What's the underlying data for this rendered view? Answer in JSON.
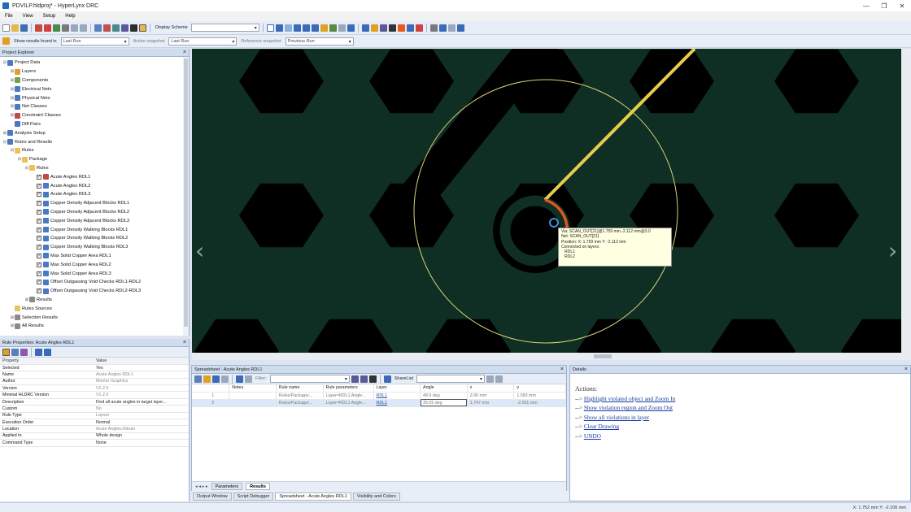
{
  "window": {
    "title": "PDVILP.hldproj* - HyperLynx DRC",
    "minimize": "—",
    "maximize": "❐",
    "close": "✕"
  },
  "menu": [
    "File",
    "View",
    "Setup",
    "Help"
  ],
  "toolbar1": {
    "display_scheme_label": "Display Scheme",
    "display_scheme_value": ""
  },
  "toolbar2": {
    "show_label": "Show results found in",
    "show_value": "Last Run",
    "active_label": "Active snapshot",
    "active_value": "Last Run",
    "reference_label": "Reference snapshot",
    "reference_value": "Previous Run"
  },
  "explorer": {
    "title": "Project Explorer",
    "items": [
      {
        "label": "Project Data",
        "level": 0,
        "exp": "⊟",
        "icon": "#4a78c2"
      },
      {
        "label": "Layers",
        "level": 1,
        "exp": "⊞",
        "icon": "#e0a030"
      },
      {
        "label": "Components",
        "level": 1,
        "exp": "⊞",
        "icon": "#7aa04a"
      },
      {
        "label": "Electrical Nets",
        "level": 1,
        "exp": "⊞",
        "icon": "#4a78c2"
      },
      {
        "label": "Physical Nets",
        "level": 1,
        "exp": "⊞",
        "icon": "#4a78c2"
      },
      {
        "label": "Net Classes",
        "level": 1,
        "exp": "⊞",
        "icon": "#4a78c2"
      },
      {
        "label": "Constraint Classes",
        "level": 1,
        "exp": "⊞",
        "icon": "#c04a4a"
      },
      {
        "label": "Diff Pairs",
        "level": 1,
        "exp": "",
        "icon": "#4a78c2"
      },
      {
        "label": "Analysis Setup",
        "level": 0,
        "exp": "⊞",
        "icon": "#4a78c2"
      },
      {
        "label": "Rules and Results",
        "level": 0,
        "exp": "⊟",
        "icon": "#4a78c2"
      },
      {
        "label": "Rules",
        "level": 1,
        "exp": "⊟",
        "icon": "#e8c45a"
      },
      {
        "label": "Package",
        "level": 2,
        "exp": "⊟",
        "icon": "#e8c45a"
      },
      {
        "label": "Rules",
        "level": 3,
        "exp": "⊟",
        "icon": "#e8c45a"
      },
      {
        "label": "Acute Angles RDL1",
        "level": 4,
        "cb": true,
        "icon": "#c04a4a"
      },
      {
        "label": "Acute Angles RDL2",
        "level": 4,
        "cb": true,
        "icon": "#4a78c2"
      },
      {
        "label": "Acute Angles RDL3",
        "level": 4,
        "cb": true,
        "icon": "#4a78c2"
      },
      {
        "label": "Copper Density Adjacent Blocks RDL1",
        "level": 4,
        "cb": true,
        "icon": "#4a78c2"
      },
      {
        "label": "Copper Density Adjacent Blocks RDL2",
        "level": 4,
        "cb": true,
        "icon": "#4a78c2"
      },
      {
        "label": "Copper Density Adjacent Blocks RDL3",
        "level": 4,
        "cb": true,
        "icon": "#4a78c2"
      },
      {
        "label": "Copper Density Walking Blocks RDL1",
        "level": 4,
        "cb": true,
        "icon": "#4a78c2"
      },
      {
        "label": "Copper Density Walking Blocks RDL2",
        "level": 4,
        "cb": true,
        "icon": "#4a78c2"
      },
      {
        "label": "Copper Density Walking Blocks RDL3",
        "level": 4,
        "cb": true,
        "icon": "#4a78c2"
      },
      {
        "label": "Max Solid Copper Area RDL1",
        "level": 4,
        "cb": true,
        "icon": "#4a78c2"
      },
      {
        "label": "Max Solid Copper Area RDL2",
        "level": 4,
        "cb": true,
        "icon": "#4a78c2"
      },
      {
        "label": "Max Solid Copper Area RDL3",
        "level": 4,
        "cb": true,
        "icon": "#4a78c2"
      },
      {
        "label": "Offset Outgassing Void Checks RDL1-RDL2",
        "level": 4,
        "cb": true,
        "icon": "#4a78c2"
      },
      {
        "label": "Offset Outgassing Void Checks RDL2-RDL3",
        "level": 4,
        "cb": true,
        "icon": "#4a78c2"
      },
      {
        "label": "Results",
        "level": 3,
        "exp": "⊞",
        "icon": "#8a8a8a"
      },
      {
        "label": "Rules Sources",
        "level": 1,
        "exp": "",
        "icon": "#e8c45a"
      },
      {
        "label": "Selection Results",
        "level": 1,
        "exp": "⊞",
        "icon": "#8a8a8a"
      },
      {
        "label": "All Results",
        "level": 1,
        "exp": "⊞",
        "icon": "#8a8a8a"
      }
    ]
  },
  "properties": {
    "title": "Rule Properties: Acute Angles RDL1",
    "col_property": "Property",
    "col_value": "Value",
    "rows": [
      {
        "k": "Selected",
        "v": "Yes",
        "gray": false
      },
      {
        "k": "Name",
        "v": "Acute Angles RDL1",
        "gray": true
      },
      {
        "k": "Author",
        "v": "Mentor Graphics",
        "gray": true
      },
      {
        "k": "Version",
        "v": "V1.2.0",
        "gray": true
      },
      {
        "k": "Minimal HLDRC Version",
        "v": "V1.2.0",
        "gray": true
      },
      {
        "k": "Description",
        "v": "Find all acute angles in target layer...",
        "gray": false
      },
      {
        "k": "Custom",
        "v": "No",
        "gray": true
      },
      {
        "k": "Rule Type",
        "v": "Layout",
        "gray": true
      },
      {
        "k": "Execution Order",
        "v": "Normal",
        "gray": false
      },
      {
        "k": "Location",
        "v": "Acute Angles.hldrule",
        "gray": true
      },
      {
        "k": "Applied to",
        "v": "Whole design",
        "gray": false
      },
      {
        "k": "Command Type",
        "v": "None",
        "gray": false
      }
    ]
  },
  "canvas": {
    "tooltip": [
      "Via: SCAN_OUT[21]@1.759 mm,-2.112 mm@3.0",
      "Net: SCAN_OUT[21]",
      "Position: X: 1.759 mm Y: -2.112 mm",
      "Connected on layers:",
      "   RDL1",
      "   RDL2"
    ]
  },
  "spreadsheet": {
    "title": "Spreadsheet - Acute Angles RDL1",
    "filter_label": "Filter:",
    "share_label": "ShareList",
    "columns": [
      "",
      "Notes",
      "Rule name",
      "Rule parameters",
      "Layer",
      "Angle",
      "x",
      "y"
    ],
    "rows": [
      {
        "n": "1",
        "notes": "",
        "rule": "Rules/Package/...",
        "params": "Layer=RDL1 Angle...",
        "layer": "RDL1",
        "angle": "48.9 deg",
        "x": "2.06 mm",
        "y": "1.583 mm"
      },
      {
        "n": "2",
        "notes": "",
        "rule": "Rules/Package/...",
        "params": "Layer=RDL1 Angle...",
        "layer": "RDL1",
        "angle": "35.05 deg",
        "x": "1.747 mm",
        "y": "-2.091 mm"
      }
    ],
    "tabs": [
      "Parameters",
      "Results"
    ]
  },
  "details": {
    "title": "Details",
    "actions_label": "Actions:",
    "links": [
      "Highlight violated object and Zoom In",
      "Show violation region and Zoom Out",
      "Show all violations in layer",
      "Clear Drawing",
      "UNDO"
    ]
  },
  "bottom_tabs": [
    "Output Window",
    "Script Debugger",
    "Spreadsheet - Acute Angles RDL1",
    "Visibility and Colors"
  ],
  "status": {
    "coords": "X: 1.752 mm  Y: -2.106 mm"
  },
  "colors": {
    "board": "#0f2f24",
    "hex": "#000000",
    "trace": "#e8cd4a",
    "highlight": "#e25522",
    "circle": "#d9d27a",
    "via": "#3f8fd8"
  }
}
